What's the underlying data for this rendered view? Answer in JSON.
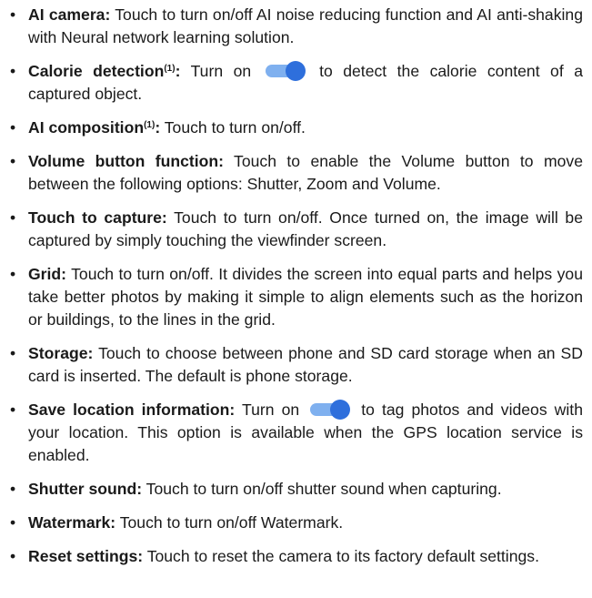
{
  "colors": {
    "toggle_track": "#7fb0ef",
    "toggle_knob": "#2e6fdc",
    "text": "#1a1a1a"
  },
  "icons": {
    "toggle": "toggle-switch-on-icon"
  },
  "items": [
    {
      "term": "AI camera:",
      "text": " Touch to turn on/off AI noise reducing function and AI anti-shaking with Neural network learning solution."
    },
    {
      "term": "Calorie detection",
      "note": "(1)",
      "colon": ":",
      "before": " Turn on ",
      "after": " to detect the calorie content of a captured object."
    },
    {
      "term": "AI composition",
      "note": "(1)",
      "colon": ":",
      "text": " Touch to turn on/off."
    },
    {
      "term": "Volume button function:",
      "text": " Touch to enable the Volume button to move between the following options: Shutter, Zoom and Volume."
    },
    {
      "term": "Touch to capture:",
      "text": " Touch to turn on/off. Once turned on, the image will be captured by simply touching the viewfinder screen."
    },
    {
      "term": "Grid:",
      "text": " Touch to turn on/off. It divides the screen into equal parts and helps you take better photos by making it simple to align elements such as the horizon or buildings, to the lines in the grid."
    },
    {
      "term": "Storage:",
      "text": " Touch to choose between phone and SD card storage when an SD card is inserted. The default is phone storage."
    },
    {
      "term": "Save location information:",
      "before": " Turn on ",
      "after": " to tag photos and videos with your location. This option is available when the GPS location service is enabled."
    },
    {
      "term": "Shutter sound:",
      "text": " Touch to turn on/off shutter sound when capturing."
    },
    {
      "term": "Watermark:",
      "text": " Touch to turn on/off Watermark."
    },
    {
      "term": "Reset settings:",
      "text": " Touch to reset the camera to its factory default settings."
    }
  ]
}
